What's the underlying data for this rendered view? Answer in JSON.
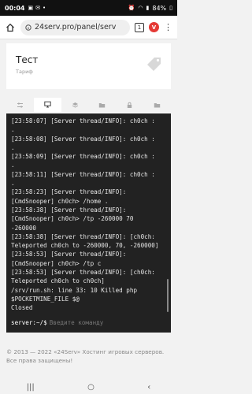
{
  "statusbar": {
    "time": "00:04",
    "battery": "84%"
  },
  "browser": {
    "url": "24serv.pro/panel/serv",
    "tab_count": "1"
  },
  "server": {
    "title": "Тест",
    "subtitle": "Тариф"
  },
  "tabs": [
    {
      "icon": "settings-sliders-icon",
      "active": false
    },
    {
      "icon": "monitor-icon",
      "active": true
    },
    {
      "icon": "layers-icon",
      "active": false
    },
    {
      "icon": "folder-icon",
      "active": false
    },
    {
      "icon": "lock-icon",
      "active": false
    },
    {
      "icon": "folder-icon",
      "active": false
    }
  ],
  "console": {
    "lines": [
      "[23:58:07] [Server thread/INFO]: ch0ch :",
      ".",
      "[23:58:08] [Server thread/INFO]: ch0ch :",
      ".",
      "[23:58:09] [Server thread/INFO]: ch0ch :",
      ".",
      "[23:58:11] [Server thread/INFO]: ch0ch :",
      ".",
      "[23:58:23] [Server thread/INFO]:",
      "[CmdSnooper] ch0ch> /home .",
      "[23:58:38] [Server thread/INFO]:",
      "[CmdSnooper] ch0ch> /tp -260000 70",
      "-260000",
      "[23:58:38] [Server thread/INFO]: [ch0ch:",
      "Teleported ch0ch to -260000, 70, -260000]",
      "[23:58:53] [Server thread/INFO]:",
      "[CmdSnooper] ch0ch> /tp c",
      "[23:58:53] [Server thread/INFO]: [ch0ch:",
      "Teleported ch0ch to ch0ch]",
      "/srv/run.sh: line 33: 10 Killed php",
      "$POCKETMINE_FILE $@",
      "Closed"
    ],
    "prompt": "server:~/$",
    "input_placeholder": "Введите команду"
  },
  "footer": {
    "text": "© 2013 — 2022 «24Serv» Хостинг игровых серверов. Все права защищены!"
  }
}
